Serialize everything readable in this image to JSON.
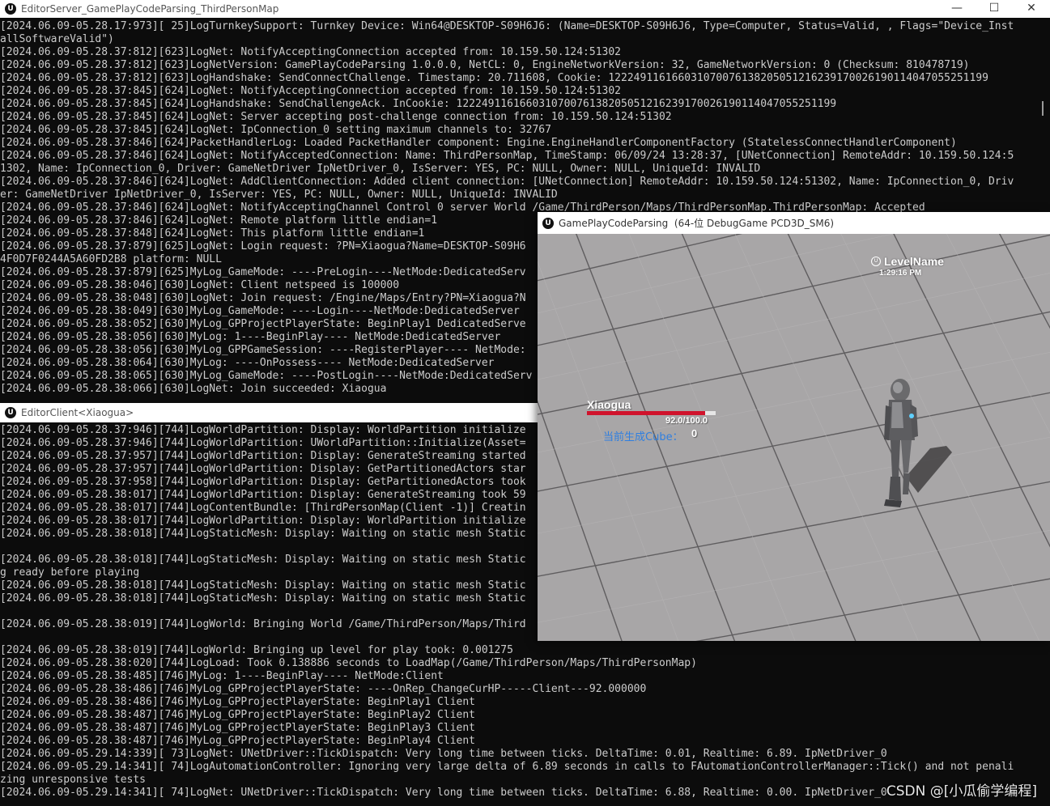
{
  "server": {
    "title": "EditorServer_GamePlayCodeParsing_ThirdPersonMap",
    "controls": [
      "—",
      "☐",
      "✕"
    ],
    "lines": [
      "[2024.06.09-05.28.17:973][ 25]LogTurnkeySupport: Turnkey Device: Win64@DESKTOP-S09H6J6: (Name=DESKTOP-S09H6J6, Type=Computer, Status=Valid, , Flags=\"Device_Inst",
      "allSoftwareValid\")",
      "[2024.06.09-05.28.37:812][623]LogNet: NotifyAcceptingConnection accepted from: 10.159.50.124:51302",
      "[2024.06.09-05.28.37:812][623]LogNetVersion: GamePlayCodeParsing 1.0.0.0, NetCL: 0, EngineNetworkVersion: 32, GameNetworkVersion: 0 (Checksum: 810478719)",
      "[2024.06.09-05.28.37:812][623]LogHandshake: SendConnectChallenge. Timestamp: 20.711608, Cookie: 122249116166031070076138205051216239170026190114047055251199",
      "[2024.06.09-05.28.37:845][624]LogNet: NotifyAcceptingConnection accepted from: 10.159.50.124:51302",
      "[2024.06.09-05.28.37:845][624]LogHandshake: SendChallengeAck. InCookie: 122249116166031070076138205051216239170026190114047055251199",
      "[2024.06.09-05.28.37:845][624]LogNet: Server accepting post-challenge connection from: 10.159.50.124:51302",
      "[2024.06.09-05.28.37:845][624]LogNet: IpConnection_0 setting maximum channels to: 32767",
      "[2024.06.09-05.28.37:846][624]PacketHandlerLog: Loaded PacketHandler component: Engine.EngineHandlerComponentFactory (StatelessConnectHandlerComponent)",
      "[2024.06.09-05.28.37:846][624]LogNet: NotifyAcceptedConnection: Name: ThirdPersonMap, TimeStamp: 06/09/24 13:28:37, [UNetConnection] RemoteAddr: 10.159.50.124:5",
      "1302, Name: IpConnection_0, Driver: GameNetDriver IpNetDriver_0, IsServer: YES, PC: NULL, Owner: NULL, UniqueId: INVALID",
      "[2024.06.09-05.28.37:846][624]LogNet: AddClientConnection: Added client connection: [UNetConnection] RemoteAddr: 10.159.50.124:51302, Name: IpConnection_0, Driv",
      "er: GameNetDriver IpNetDriver_0, IsServer: YES, PC: NULL, Owner: NULL, UniqueId: INVALID",
      "[2024.06.09-05.28.37:846][624]LogNet: NotifyAcceptingChannel Control 0 server World /Game/ThirdPerson/Maps/ThirdPersonMap.ThirdPersonMap: Accepted",
      "[2024.06.09-05.28.37:846][624]LogNet: Remote platform little endian=1",
      "[2024.06.09-05.28.37:848][624]LogNet: This platform little endian=1",
      "[2024.06.09-05.28.37:879][625]LogNet: Login request: ?PN=Xiaogua?Name=DESKTOP-S09H6",
      "4F0D7F0244A5A60FD2B8 platform: NULL",
      "[2024.06.09-05.28.37:879][625]MyLog_GameMode: ----PreLogin----NetMode:DedicatedServ",
      "[2024.06.09-05.28.38:046][630]LogNet: Client netspeed is 100000",
      "[2024.06.09-05.28.38:048][630]LogNet: Join request: /Engine/Maps/Entry?PN=Xiaogua?N",
      "[2024.06.09-05.28.38:049][630]MyLog_GameMode: ----Login----NetMode:DedicatedServer",
      "[2024.06.09-05.28.38:052][630]MyLog_GPProjectPlayerState: BeginPlay1 DedicatedServe",
      "[2024.06.09-05.28.38:056][630]MyLog: 1----BeginPlay---- NetMode:DedicatedServer",
      "[2024.06.09-05.28.38:056][630]MyLog_GPPGameSession: ----RegisterPlayer---- NetMode:",
      "[2024.06.09-05.28.38:064][630]MyLog: ----OnPossess---- NetMode:DedicatedServer",
      "[2024.06.09-05.28.38:065][630]MyLog_GameMode: ----PostLogin----NetMode:DedicatedServ",
      "[2024.06.09-05.28.38:066][630]LogNet: Join succeeded: Xiaogua"
    ]
  },
  "client": {
    "title": "EditorClient<Xiaogua>",
    "lines": [
      "[2024.06.09-05.28.37:946][744]LogWorldPartition: Display: WorldPartition initialize",
      "[2024.06.09-05.28.37:946][744]LogWorldPartition: UWorldPartition::Initialize(Asset=",
      "[2024.06.09-05.28.37:957][744]LogWorldPartition: Display: GenerateStreaming started",
      "[2024.06.09-05.28.37:957][744]LogWorldPartition: Display: GetPartitionedActors star",
      "[2024.06.09-05.28.37:958][744]LogWorldPartition: Display: GetPartitionedActors took",
      "[2024.06.09-05.28.38:017][744]LogWorldPartition: Display: GenerateStreaming took 59",
      "[2024.06.09-05.28.38:017][744]LogContentBundle: [ThirdPersonMap(Client -1)] Creatin",
      "[2024.06.09-05.28.38:017][744]LogWorldPartition: Display: WorldPartition initialize",
      "[2024.06.09-05.28.38:018][744]LogStaticMesh: Display: Waiting on static mesh Static",
      "",
      "[2024.06.09-05.28.38:018][744]LogStaticMesh: Display: Waiting on static mesh Static",
      "g ready before playing",
      "[2024.06.09-05.28.38:018][744]LogStaticMesh: Display: Waiting on static mesh Static",
      "[2024.06.09-05.28.38:018][744]LogStaticMesh: Display: Waiting on static mesh Static",
      "",
      "[2024.06.09-05.28.38:019][744]LogWorld: Bringing World /Game/ThirdPerson/Maps/Third",
      "",
      "[2024.06.09-05.28.38:019][744]LogWorld: Bringing up level for play took: 0.001275",
      "[2024.06.09-05.28.38:020][744]LogLoad: Took 0.138886 seconds to LoadMap(/Game/ThirdPerson/Maps/ThirdPersonMap)",
      "[2024.06.09-05.28.38:485][746]MyLog: 1----BeginPlay---- NetMode:Client",
      "[2024.06.09-05.28.38:486][746]MyLog_GPProjectPlayerState: ----OnRep_ChangeCurHP-----Client---92.000000",
      "[2024.06.09-05.28.38:486][746]MyLog_GPProjectPlayerState: BeginPlay1 Client",
      "[2024.06.09-05.28.38:487][746]MyLog_GPProjectPlayerState: BeginPlay2 Client",
      "[2024.06.09-05.28.38:487][746]MyLog_GPProjectPlayerState: BeginPlay3 Client",
      "[2024.06.09-05.28.38:487][746]MyLog_GPProjectPlayerState: BeginPlay4 Client",
      "[2024.06.09-05.29.14:339][ 73]LogNet: UNetDriver::TickDispatch: Very long time between ticks. DeltaTime: 0.01, Realtime: 6.89. IpNetDriver_0",
      "[2024.06.09-05.29.14:341][ 74]LogAutomationController: Ignoring very large delta of 6.89 seconds in calls to FAutomationControllerManager::Tick() and not penali",
      "zing unresponsive tests",
      "[2024.06.09-05.29.14:341][ 74]LogNet: UNetDriver::TickDispatch: Very long time between ticks. DeltaTime: 6.88, Realtime: 0.00. IpNetDriver_0"
    ]
  },
  "game": {
    "title": "GamePlayCodeParsing  (64-位 DebugGame PCD3D_SM6)",
    "hud": {
      "level_name": "LevelName",
      "time": "1:29:16 PM",
      "player_name": "Xiaogua",
      "hp_text": "92.0/100.0",
      "hp_fraction": 0.92,
      "hp_color": "#d0132c",
      "cube_label": "当前生成Cube：",
      "cube_count": "0"
    },
    "floor_color": "#a8a6a7",
    "grid_color": "#5f5d5f"
  },
  "watermark": "CSDN @[小瓜偷学编程]"
}
